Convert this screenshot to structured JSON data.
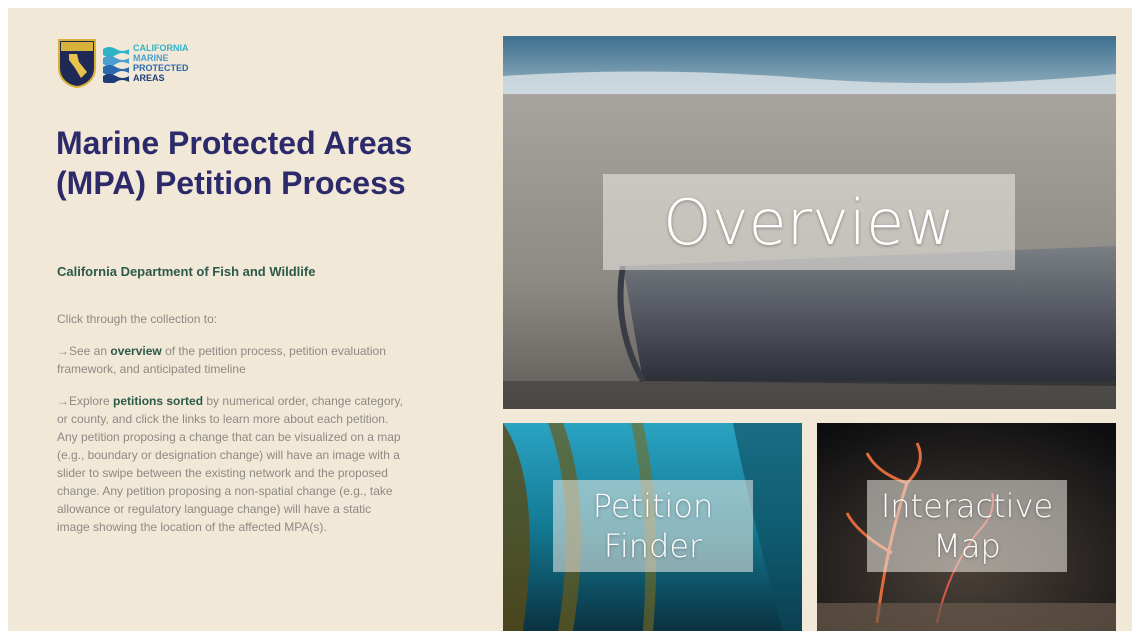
{
  "logo": {
    "badge_text": "CALIFORNIA",
    "wordmark": [
      "CALIFORNIA",
      "MARINE",
      "PROTECTED",
      "AREAS"
    ]
  },
  "page_title": "Marine Protected Areas (MPA) Petition Process",
  "subtitle": "California Department of Fish and Wildlife",
  "intro": "Click through the collection to:",
  "item1": {
    "prefix": "→See an ",
    "bold": "overview",
    "suffix": " of the petition process, petition evaluation framework, and anticipated timeline"
  },
  "item2": {
    "prefix": "→Explore ",
    "bold": "petitions sorted",
    "suffix": " by numerical order, change category, or county, and click the links to learn more about each petition. Any petition proposing a change that can be visualized on a map (e.g., boundary or designation change) will have an image with a slider to swipe between the existing network and the proposed change. Any petition proposing a non-spatial change (e.g., take allowance or regulatory language change) will have a static image showing the location of the affected MPA(s)."
  },
  "tiles": {
    "overview": "Overview",
    "petition_finder": "Petition Finder",
    "interactive_map": "Interactive Map"
  }
}
